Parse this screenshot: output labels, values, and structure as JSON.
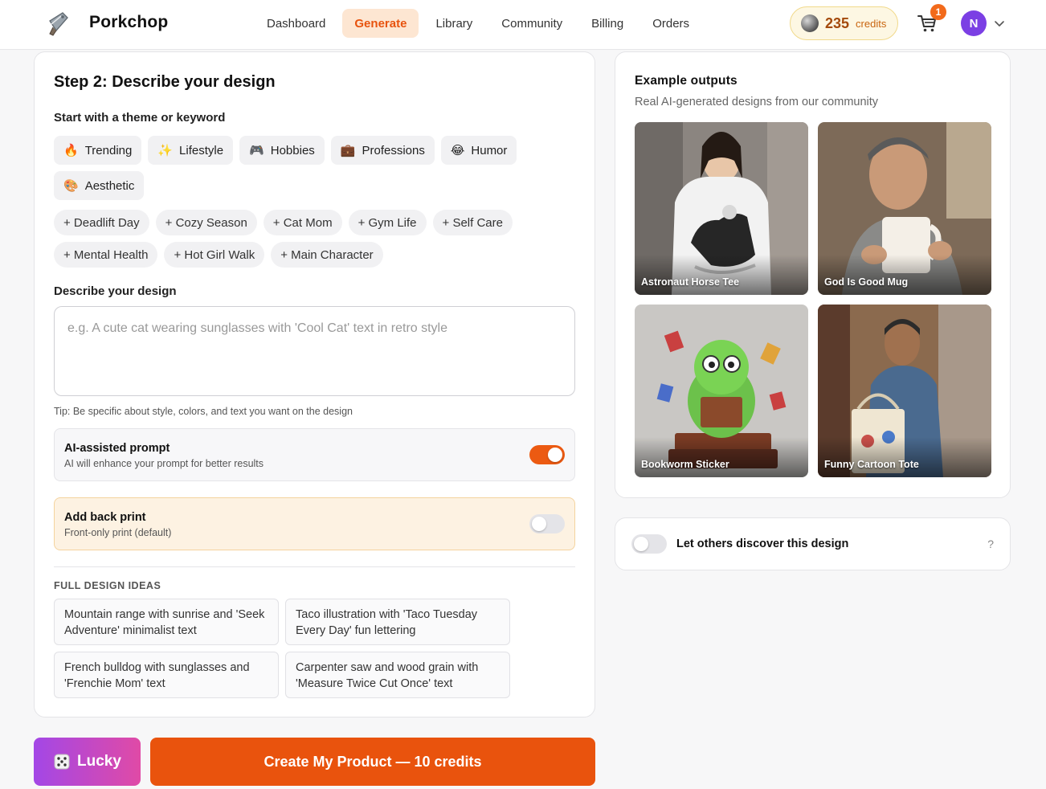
{
  "header": {
    "brand": "Porkchop",
    "nav": [
      "Dashboard",
      "Generate",
      "Library",
      "Community",
      "Billing",
      "Orders"
    ],
    "active_nav": "Generate",
    "credits_value": "235",
    "credits_label": "credits",
    "cart_count": "1",
    "avatar_initial": "N",
    "accent_color": "#e9530d"
  },
  "step": {
    "title": "Step 2: Describe your design",
    "theme_label": "Start with a theme or keyword",
    "themes": [
      {
        "icon": "fire-icon",
        "emoji": "🔥",
        "label": "Trending"
      },
      {
        "icon": "sparkles-icon",
        "emoji": "✨",
        "label": "Lifestyle"
      },
      {
        "icon": "gamepad-icon",
        "emoji": "🎮",
        "label": "Hobbies"
      },
      {
        "icon": "briefcase-icon",
        "emoji": "💼",
        "label": "Professions"
      },
      {
        "icon": "laughing-face-icon",
        "emoji": "😂",
        "label": "Humor"
      },
      {
        "icon": "palette-icon",
        "emoji": "🎨",
        "label": "Aesthetic"
      }
    ],
    "keywords": [
      "+ Deadlift Day",
      "+ Cozy Season",
      "+ Cat Mom",
      "+ Gym Life",
      "+ Self Care",
      "+ Mental Health",
      "+ Hot Girl Walk",
      "+ Main Character"
    ],
    "describe_label": "Describe your design",
    "describe_placeholder": "e.g. A cute cat wearing sunglasses with 'Cool Cat' text in retro style",
    "tip": "Tip: Be specific about style, colors, and text you want on the design",
    "ai_prompt": {
      "title": "AI-assisted prompt",
      "subtitle": "AI will enhance your prompt for better results",
      "enabled": true
    },
    "back_print": {
      "title": "Add back print",
      "subtitle": "Front-only print (default)",
      "enabled": false
    },
    "ideas_heading": "FULL DESIGN IDEAS",
    "ideas": [
      "Mountain range with sunrise and 'Seek Adventure' minimalist text",
      "Taco illustration with 'Taco Tuesday Every Day' fun lettering",
      "French bulldog with sunglasses and 'Frenchie Mom' text",
      "Carpenter saw and wood grain with 'Measure Twice Cut Once' text"
    ]
  },
  "actions": {
    "lucky_label": "Lucky",
    "create_label": "Create My Product — 10 credits"
  },
  "examples": {
    "title": "Example outputs",
    "subtitle": "Real AI-generated designs from our community",
    "items": [
      "Astronaut Horse Tee",
      "God Is Good Mug",
      "Bookworm Sticker",
      "Funny Cartoon Tote"
    ]
  },
  "discover": {
    "label": "Let others discover this design",
    "help": "?",
    "enabled": false
  }
}
